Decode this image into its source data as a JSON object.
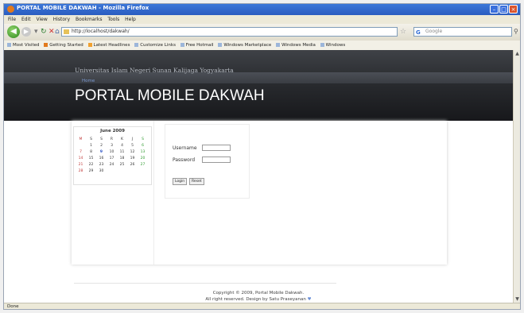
{
  "window": {
    "title": "PORTAL MOBILE DAKWAH - Mozilla Firefox"
  },
  "menu": [
    "File",
    "Edit",
    "View",
    "History",
    "Bookmarks",
    "Tools",
    "Help"
  ],
  "nav": {
    "url": "http://localhost/dakwah/",
    "search_placeholder": "Google"
  },
  "bookmarks": [
    "Most Visited",
    "Getting Started",
    "Latest Headlines",
    "Customize Links",
    "Free Hotmail",
    "Windows Marketplace",
    "Windows Media",
    "Windows"
  ],
  "page": {
    "university": "Universitas Islam Negeri Sunan Kalijaga Yogyakarta",
    "home_link": "Home",
    "portal_title": "PORTAL MOBILE DAKWAH"
  },
  "calendar": {
    "month": "June 2009",
    "weekdays": [
      "M",
      "S",
      "S",
      "R",
      "K",
      "J",
      "S"
    ],
    "weeks": [
      [
        "",
        "1",
        "2",
        "3",
        "4",
        "5",
        "6"
      ],
      [
        "7",
        "8",
        "9",
        "10",
        "11",
        "12",
        "13"
      ],
      [
        "14",
        "15",
        "16",
        "17",
        "18",
        "19",
        "20"
      ],
      [
        "21",
        "22",
        "23",
        "24",
        "25",
        "26",
        "27"
      ],
      [
        "28",
        "29",
        "30",
        "",
        "",
        "",
        ""
      ]
    ]
  },
  "login": {
    "username_label": "Username",
    "password_label": "Password",
    "login_button": "Login",
    "reset_button": "Reset"
  },
  "footer": {
    "copyright": "Copyright © 2009, Portal Mobile Dakwah.",
    "credits": "All right reserved. Design by Satu Praseyanan",
    "symbol": "♥"
  },
  "status": {
    "text": "Done"
  }
}
